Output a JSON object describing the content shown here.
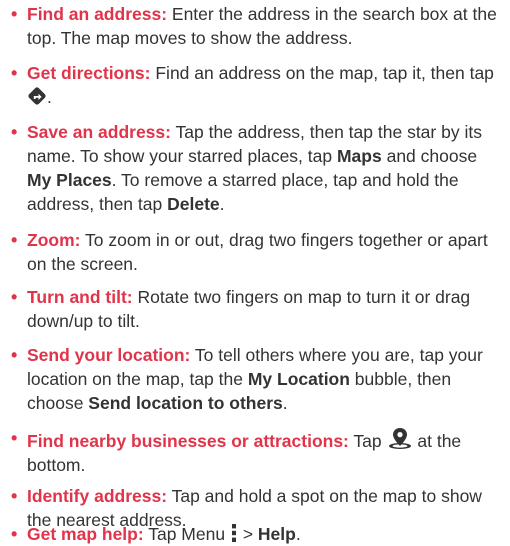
{
  "colors": {
    "accent": "#e0344a",
    "text": "#333333"
  },
  "items": [
    {
      "lead": "Find an address:",
      "text": " Enter the address in the search box at the top. The map moves to show the address."
    },
    {
      "lead": "Get directions:",
      "text": " Find an address on the map, tap it, then tap ",
      "icon": "directions-icon",
      "text2": "."
    },
    {
      "lead": "Save an address:",
      "text": " Tap the address, then tap the star by its name. To show your starred places, tap ",
      "b1": "Maps",
      "t2": " and choose ",
      "b2": "My Places",
      "t3": ". To remove a starred place, tap and hold the address, then tap ",
      "b3": "Delete",
      "t4": "."
    },
    {
      "lead": "Zoom:",
      "text": " To zoom in or out, drag two fingers together or apart on the screen."
    },
    {
      "lead": "Turn and tilt:",
      "text": " Rotate two fingers on map to turn it or drag down/up to tilt."
    },
    {
      "lead": "Send your location:",
      "text": " To tell others where you are, tap your location on the map, tap the ",
      "b1": "My Location",
      "t2": " bubble, then choose ",
      "b2": "Send location to others",
      "t3": "."
    },
    {
      "lead": "Find nearby businesses or attractions:",
      "text": " Tap ",
      "icon": "place-pin-icon",
      "text2": " at the bottom."
    },
    {
      "lead": "Identify address:",
      "text": " Tap and hold a spot on the map to show the nearest address."
    },
    {
      "lead": "Get map help:",
      "text": " Tap Menu ",
      "icon": "menu-icon",
      "text2": " > ",
      "b1": "Help",
      "t2": "."
    }
  ]
}
